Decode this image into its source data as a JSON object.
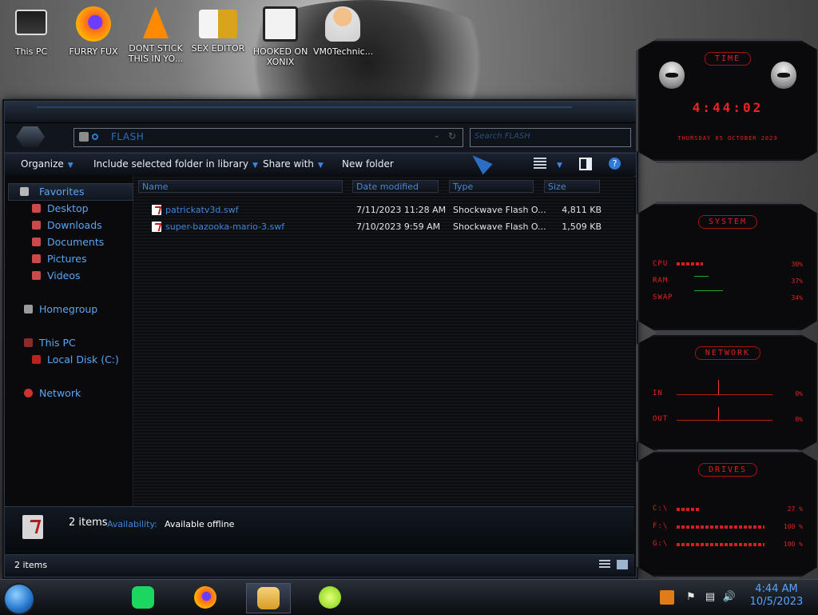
{
  "desktop": {
    "icons": [
      {
        "label": "This PC"
      },
      {
        "label": "FURRY FUX"
      },
      {
        "label": "DONT STICK THIS IN YO..."
      },
      {
        "label": "SEX EDITOR"
      },
      {
        "label": "HOOKED ON XONIX"
      },
      {
        "label": "VM0Technic..."
      }
    ]
  },
  "explorer": {
    "address": {
      "path": "FLASH",
      "dropdown_glyph": "⌄",
      "refresh_glyph": "↻"
    },
    "search": {
      "placeholder": "Search FLASH"
    },
    "toolbar": {
      "organize": "Organize",
      "include": "Include selected folder in library",
      "share": "Share with",
      "new_folder": "New folder"
    },
    "nav": {
      "favorites": "Favorites",
      "desktop": "Desktop",
      "downloads": "Downloads",
      "documents": "Documents",
      "pictures": "Pictures",
      "videos": "Videos",
      "homegroup": "Homegroup",
      "this_pc": "This PC",
      "local_disk": "Local Disk (C:)",
      "network": "Network"
    },
    "columns": {
      "name": "Name",
      "date": "Date modified",
      "type": "Type",
      "size": "Size"
    },
    "files": [
      {
        "name": "patrickatv3d.swf",
        "date": "7/11/2023 11:28 AM",
        "type": "Shockwave Flash O...",
        "size": "4,811 KB"
      },
      {
        "name": "super-bazooka-mario-3.swf",
        "date": "7/10/2023 9:59 AM",
        "type": "Shockwave Flash O...",
        "size": "1,509 KB"
      }
    ],
    "details": {
      "count": "2 items",
      "availability_label": "Availability:",
      "availability_value": "Available offline"
    },
    "status": "2 items"
  },
  "gadgets": {
    "time": {
      "title": "TIME",
      "clock": "4:44:02",
      "date": "THURSDAY 05 OCTOBER 2023"
    },
    "system": {
      "title": "SYSTEM",
      "cpu_label": "CPU",
      "cpu_val": "30%",
      "cpu": 0.3,
      "ram_label": "RAM",
      "ram_val": "37%",
      "ram": 0.37,
      "swap_label": "SWAP",
      "swap_val": "34%",
      "swap": 0.34
    },
    "network": {
      "title": "NETWORK",
      "in_label": "IN",
      "in_val": "0%",
      "out_label": "OUT",
      "out_val": "0%"
    },
    "drives": {
      "title": "DRIVES",
      "items": [
        {
          "label": "C:\\",
          "value": "27 %",
          "fill": 0.27
        },
        {
          "label": "F:\\",
          "value": "100 %",
          "fill": 1.0
        },
        {
          "label": "G:\\",
          "value": "100 %",
          "fill": 1.0
        }
      ]
    }
  },
  "taskbar": {
    "time": "4:44 AM",
    "date": "10/5/2023"
  },
  "colors": {
    "accent": "#2f7ad8",
    "gadget_red": "#e02020",
    "window_bg": "#0b0b0e"
  }
}
